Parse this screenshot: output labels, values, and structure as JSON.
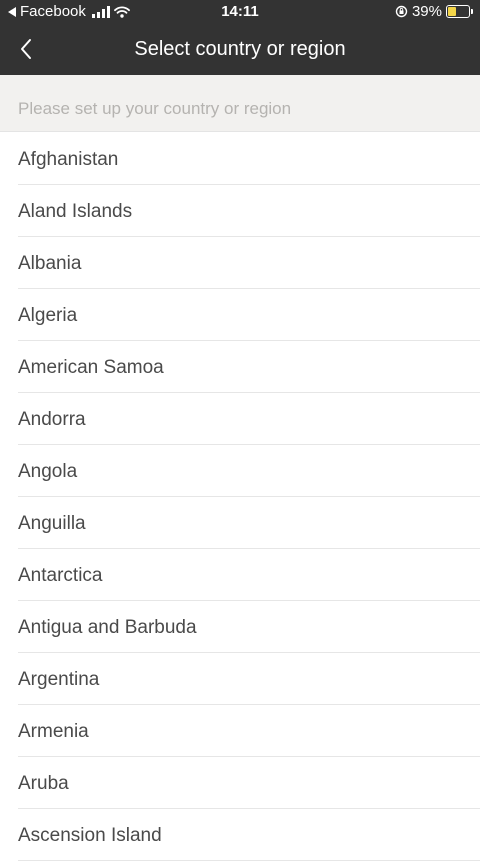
{
  "status_bar": {
    "back_app": "Facebook",
    "time": "14:11",
    "battery_percent": "39%",
    "battery_level": 0.39,
    "icons": [
      "back-triangle-icon",
      "signal-icon",
      "wifi-icon",
      "orientation-lock-icon",
      "battery-charging-icon"
    ]
  },
  "header": {
    "title": "Select country or region",
    "back_icon": "chevron-left-icon"
  },
  "search": {
    "hint": "Please set up your country or region"
  },
  "countries": [
    "Afghanistan",
    "Aland Islands",
    "Albania",
    "Algeria",
    "American Samoa",
    "Andorra",
    "Angola",
    "Anguilla",
    "Antarctica",
    "Antigua and Barbuda",
    "Argentina",
    "Armenia",
    "Aruba",
    "Ascension Island"
  ],
  "colors": {
    "header_bg": "#333333",
    "hint_bg": "#f2f1ef",
    "text": "#4a4a4a",
    "hint_text": "#b5b3b0",
    "battery": "#f4d64a"
  }
}
